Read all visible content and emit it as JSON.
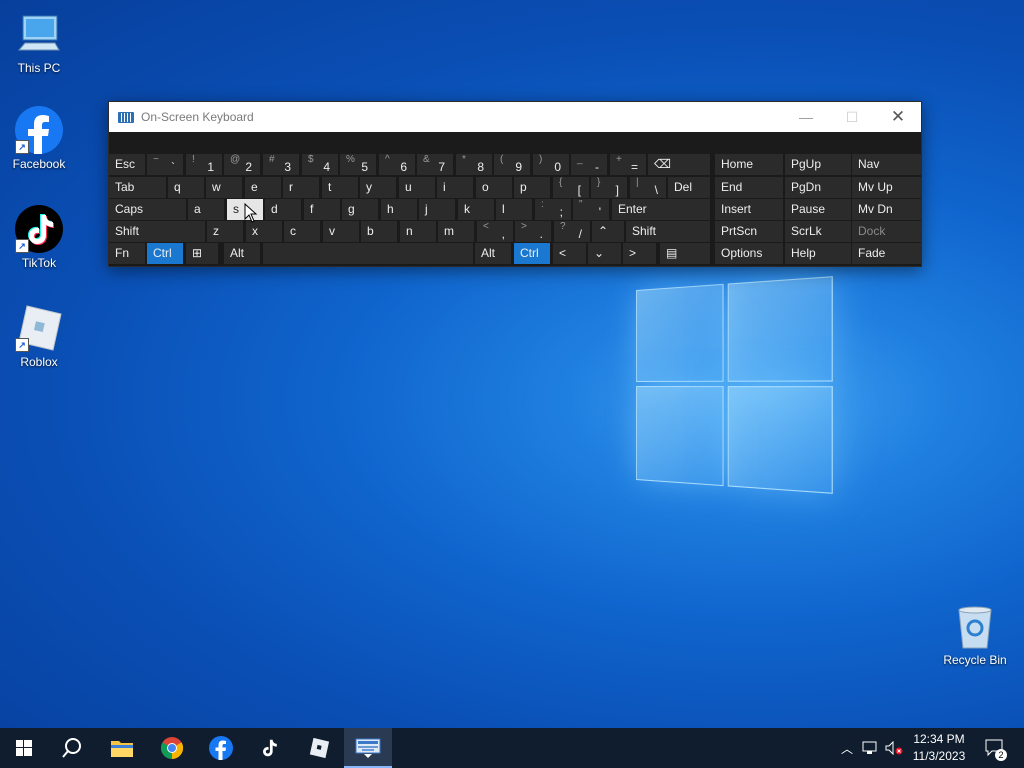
{
  "desktop": {
    "icons": [
      {
        "label": "This PC",
        "icon": "computer-icon"
      },
      {
        "label": "Facebook",
        "icon": "facebook-icon"
      },
      {
        "label": "TikTok",
        "icon": "tiktok-icon"
      },
      {
        "label": "Roblox",
        "icon": "roblox-icon"
      },
      {
        "label": "Recycle Bin",
        "icon": "recycle-bin-icon"
      }
    ]
  },
  "osk": {
    "title": "On-Screen Keyboard",
    "row1": [
      {
        "main": "Esc"
      },
      {
        "hi": "~",
        "lo": "`"
      },
      {
        "hi": "!",
        "lo": "1"
      },
      {
        "hi": "@",
        "lo": "2"
      },
      {
        "hi": "#",
        "lo": "3"
      },
      {
        "hi": "$",
        "lo": "4"
      },
      {
        "hi": "%",
        "lo": "5"
      },
      {
        "hi": "^",
        "lo": "6"
      },
      {
        "hi": "&",
        "lo": "7"
      },
      {
        "hi": "*",
        "lo": "8"
      },
      {
        "hi": "(",
        "lo": "9"
      },
      {
        "hi": ")",
        "lo": "0"
      },
      {
        "hi": "_",
        "lo": "-"
      },
      {
        "hi": "+",
        "lo": "="
      },
      {
        "main": "⌫"
      }
    ],
    "row2": [
      {
        "main": "Tab"
      },
      {
        "main": "q"
      },
      {
        "main": "w"
      },
      {
        "main": "e"
      },
      {
        "main": "r"
      },
      {
        "main": "t"
      },
      {
        "main": "y"
      },
      {
        "main": "u"
      },
      {
        "main": "i"
      },
      {
        "main": "o"
      },
      {
        "main": "p"
      },
      {
        "hi": "{",
        "lo": "["
      },
      {
        "hi": "}",
        "lo": "]"
      },
      {
        "hi": "|",
        "lo": "\\"
      },
      {
        "main": "Del"
      }
    ],
    "row3": [
      {
        "main": "Caps"
      },
      {
        "main": "a"
      },
      {
        "main": "s"
      },
      {
        "main": "d"
      },
      {
        "main": "f"
      },
      {
        "main": "g"
      },
      {
        "main": "h"
      },
      {
        "main": "j"
      },
      {
        "main": "k"
      },
      {
        "main": "l"
      },
      {
        "hi": ":",
        "lo": ";"
      },
      {
        "hi": "\"",
        "lo": "'"
      },
      {
        "main": "Enter"
      }
    ],
    "row4": [
      {
        "main": "Shift"
      },
      {
        "main": "z"
      },
      {
        "main": "x"
      },
      {
        "main": "c"
      },
      {
        "main": "v"
      },
      {
        "main": "b"
      },
      {
        "main": "n"
      },
      {
        "main": "m"
      },
      {
        "hi": "<",
        "lo": ","
      },
      {
        "hi": ">",
        "lo": "."
      },
      {
        "hi": "?",
        "lo": "/"
      },
      {
        "main": "⌃"
      },
      {
        "main": "Shift"
      }
    ],
    "row5": [
      {
        "main": "Fn"
      },
      {
        "main": "Ctrl"
      },
      {
        "main": "⊞"
      },
      {
        "main": "Alt"
      },
      {
        "main": ""
      },
      {
        "main": "Alt"
      },
      {
        "main": "Ctrl"
      },
      {
        "main": "<"
      },
      {
        "main": "⌄"
      },
      {
        "main": ">"
      },
      {
        "main": "▤"
      }
    ],
    "nav": [
      [
        "Home",
        "PgUp",
        "Nav"
      ],
      [
        "End",
        "PgDn",
        "Mv Up"
      ],
      [
        "Insert",
        "Pause",
        "Mv Dn"
      ],
      [
        "PrtScn",
        "ScrLk",
        "Dock"
      ],
      [
        "Options",
        "Help",
        "Fade"
      ]
    ]
  },
  "taskbar": {
    "clock_time": "12:34 PM",
    "clock_date": "11/3/2023",
    "notification_count": "2"
  }
}
